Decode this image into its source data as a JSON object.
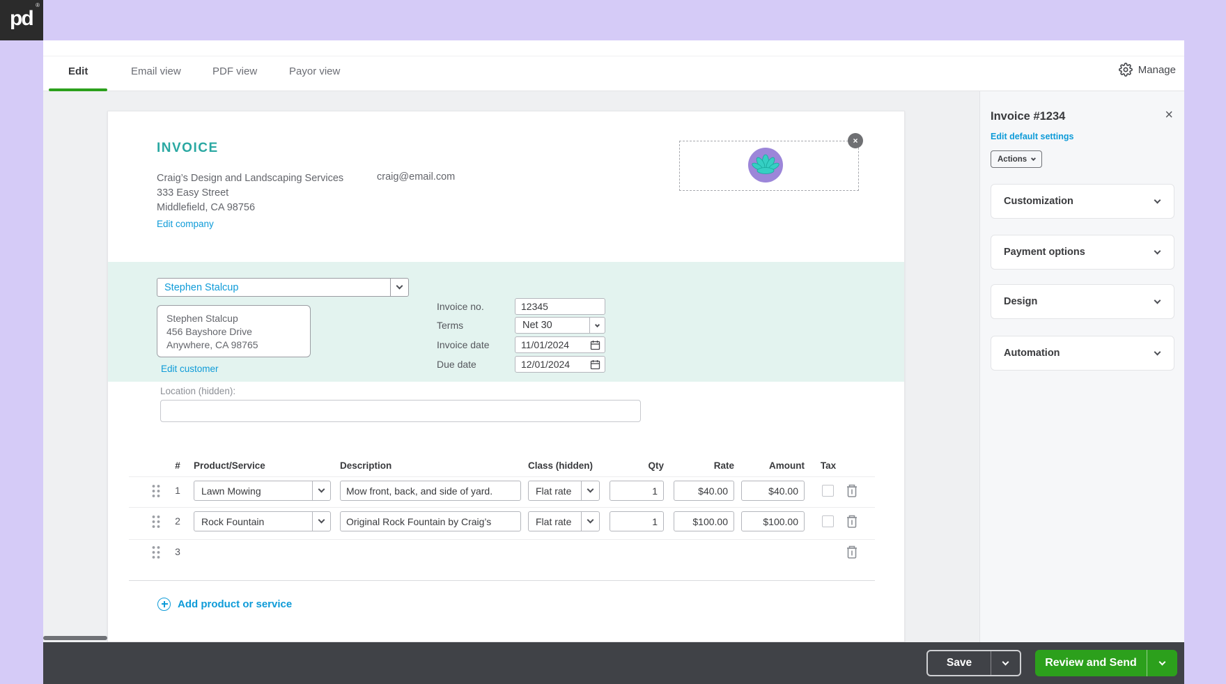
{
  "colors": {
    "brand_purple": "#d5cbf7",
    "accent_teal": "#2aa8a2",
    "link_blue": "#0e9bd8",
    "primary_green": "#2ca01c",
    "dark_bar": "#404247",
    "teal_band": "#e3f3ef"
  },
  "brand": {
    "logo_text": "pd",
    "registered_mark": "®"
  },
  "header": {
    "tabs": [
      {
        "label": "Edit",
        "active": true
      },
      {
        "label": "Email view",
        "active": false
      },
      {
        "label": "PDF view",
        "active": false
      },
      {
        "label": "Payor view",
        "active": false
      }
    ],
    "manage_label": "Manage"
  },
  "invoice_doc": {
    "title": "INVOICE",
    "company": {
      "name": "Craig’s Design and Landscaping Services",
      "address_line1": "333 Easy Street",
      "address_line2": "Middlefield, CA 98756",
      "email": "craig@email.com",
      "edit_link": "Edit company"
    },
    "customer": {
      "selected_name": "Stephen Stalcup",
      "address_line1": "Stephen Stalcup",
      "address_line2": "456 Bayshore Drive",
      "address_line3": "Anywhere, CA 98765",
      "edit_link": "Edit customer"
    },
    "details": {
      "invoice_no": {
        "label": "Invoice no.",
        "value": "12345"
      },
      "terms": {
        "label": "Terms",
        "value": "Net 30"
      },
      "invoice_date": {
        "label": "Invoice date",
        "value": "11/01/2024"
      },
      "due_date": {
        "label": "Due date",
        "value": "12/01/2024"
      }
    },
    "location": {
      "label": "Location (hidden):",
      "value": ""
    },
    "table": {
      "headers": [
        "#",
        "Product/Service",
        "Description",
        "Class (hidden)",
        "Qty",
        "Rate",
        "Amount",
        "Tax"
      ],
      "rows": [
        {
          "num": "1",
          "product": "Lawn Mowing",
          "description": "Mow front, back, and side of yard.",
          "class": "Flat rate",
          "qty": "1",
          "rate": "$40.00",
          "amount": "$40.00"
        },
        {
          "num": "2",
          "product": "Rock Fountain",
          "description": "Original Rock Fountain by Craig’s",
          "class": "Flat rate",
          "qty": "1",
          "rate": "$100.00",
          "amount": "$100.00"
        },
        {
          "num": "3"
        }
      ],
      "add_label": "Add product or service"
    }
  },
  "sidebar": {
    "title": "Invoice #1234",
    "edit_default_link": "Edit default settings",
    "actions_label": "Actions",
    "sections": [
      {
        "label": "Customization"
      },
      {
        "label": "Payment options"
      },
      {
        "label": "Design"
      },
      {
        "label": "Automation"
      }
    ]
  },
  "footer": {
    "save_label": "Save",
    "review_send_label": "Review and Send"
  }
}
